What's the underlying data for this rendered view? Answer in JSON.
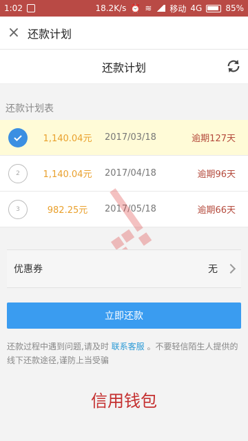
{
  "status_bar": {
    "time": "1:02",
    "network_speed": "18.2K/s",
    "carrier": "移动",
    "network_type": "4G",
    "battery": "85%"
  },
  "nav": {
    "title": "还款计划"
  },
  "header": {
    "title": "还款计划"
  },
  "section": {
    "label": "还款计划表"
  },
  "plans": [
    {
      "index": "1",
      "amount": "1,140.04元",
      "date": "2017/03/18",
      "overdue": "逾期127天",
      "selected": true
    },
    {
      "index": "2",
      "amount": "1,140.04元",
      "date": "2017/04/18",
      "overdue": "逾期96天",
      "selected": false
    },
    {
      "index": "3",
      "amount": "982.25元",
      "date": "2017/05/18",
      "overdue": "逾期66天",
      "selected": false
    }
  ],
  "coupon": {
    "label": "优惠券",
    "value": "无"
  },
  "actions": {
    "repay_label": "立即还款"
  },
  "notice": {
    "prefix": "还款过程中遇到问题,请及时",
    "link": "联系客服",
    "suffix": "。不要轻信陌生人提供的线下还款途径,谨防上当受骗"
  },
  "footer": {
    "brand": "信用钱包"
  },
  "colors": {
    "accent": "#3a9cf0",
    "overdue": "#b44a3c",
    "amount": "#e9a02c",
    "status_bar": "#b94a45"
  }
}
